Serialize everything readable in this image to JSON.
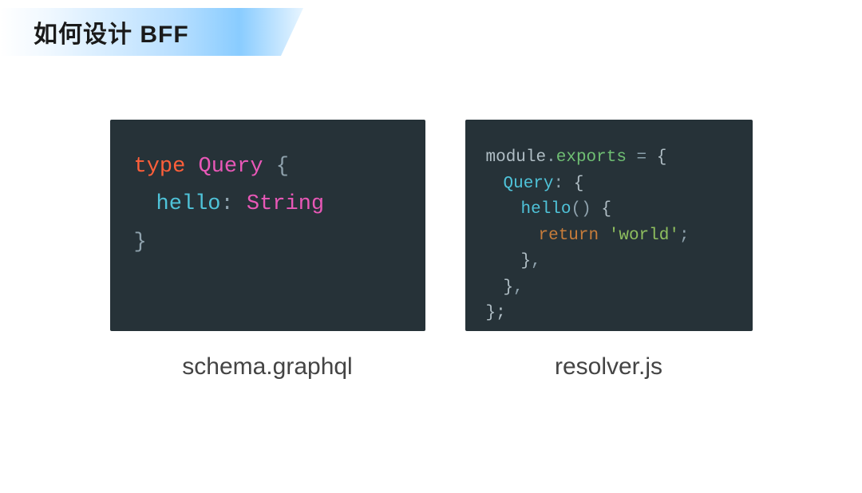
{
  "header": {
    "title": "如何设计 BFF"
  },
  "left": {
    "filename": "schema.graphql",
    "code": {
      "keyword_type": "type",
      "type_name": "Query",
      "field": "hello",
      "colon": ":",
      "field_type": "String",
      "brace_open": "{",
      "brace_close": "}"
    }
  },
  "right": {
    "filename": "resolver.js",
    "code": {
      "module": "module",
      "dot1": ".",
      "exports": "exports",
      "eq": " = ",
      "brace_open": "{",
      "query": "Query",
      "colon": ":",
      "brace_open2": " {",
      "method": "hello",
      "parens": "()",
      "brace_open3": " {",
      "return": "return",
      "string": "'world'",
      "semi": ";",
      "brace_close": "}",
      "comma": ",",
      "brace_close_final": "};"
    }
  }
}
